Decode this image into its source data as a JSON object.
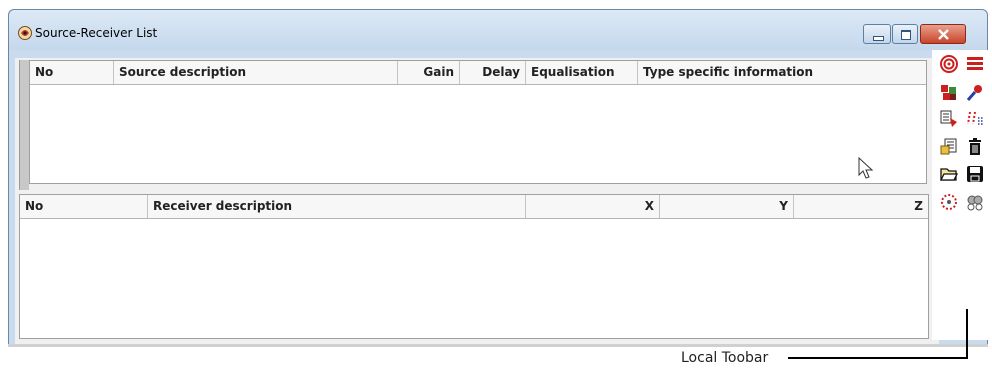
{
  "window": {
    "title": "Source-Receiver List",
    "buttons": {
      "minimize": "minimize",
      "maximize": "maximize",
      "close": "close"
    }
  },
  "source_table": {
    "columns": [
      "No",
      "Source description",
      "Gain",
      "Delay",
      "Equalisation",
      "Type specific information"
    ],
    "rows": []
  },
  "receiver_table": {
    "columns": [
      "No",
      "Receiver description",
      "X",
      "Y",
      "Z"
    ],
    "rows": []
  },
  "local_toolbar": {
    "icons": [
      "target-icon",
      "list-lines-icon",
      "edit-sources-icon",
      "microphone-icon",
      "copy-icon",
      "grid-dots-icon",
      "import-icon",
      "delete-icon",
      "open-folder-icon",
      "save-icon",
      "circle-dots-icon",
      "link-icon"
    ]
  },
  "callout": {
    "label": "Local Toobar"
  },
  "colors": {
    "accent_red": "#cc1f1f",
    "title_bg": "#c9dcef",
    "close_red": "#c8452a"
  }
}
